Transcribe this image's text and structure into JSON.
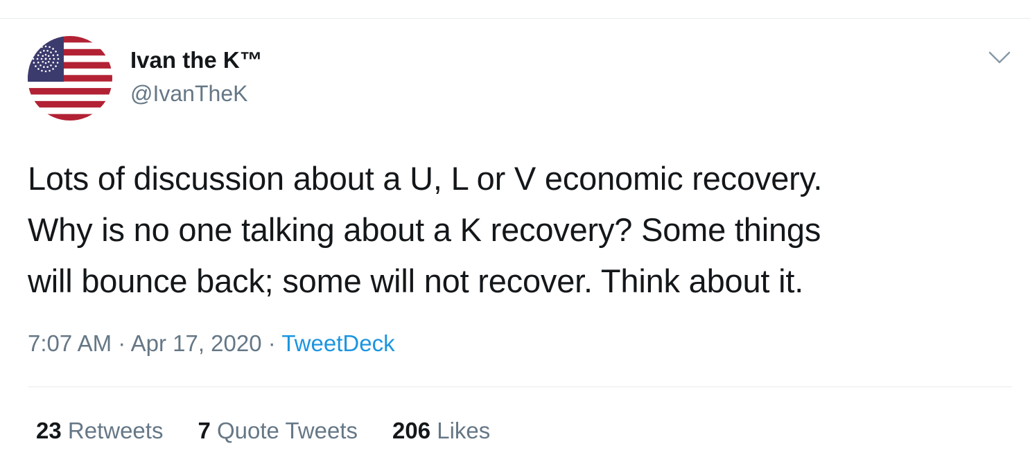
{
  "user": {
    "display_name": "Ivan the K™",
    "handle": "@IvanTheK",
    "avatar_icon": "us-flag-avatar-icon"
  },
  "menu": {
    "icon": "chevron-down-icon"
  },
  "tweet": {
    "text": "Lots of discussion about a U, L or V economic recovery.\nWhy is no one talking about a K recovery? Some things\nwill bounce back; some will not recover. Think about it."
  },
  "meta": {
    "time": "7:07 AM",
    "separator": "·",
    "date": "Apr 17, 2020",
    "source": "TweetDeck"
  },
  "stats": {
    "retweets_count": "23",
    "retweets_label": "Retweets",
    "quotes_count": "7",
    "quotes_label": "Quote Tweets",
    "likes_count": "206",
    "likes_label": "Likes"
  },
  "colors": {
    "text": "#14171a",
    "secondary": "#657786",
    "link": "#1b95e0",
    "border": "#e6ecf0",
    "flag_red": "#b22234",
    "flag_blue": "#3c3b6e"
  }
}
